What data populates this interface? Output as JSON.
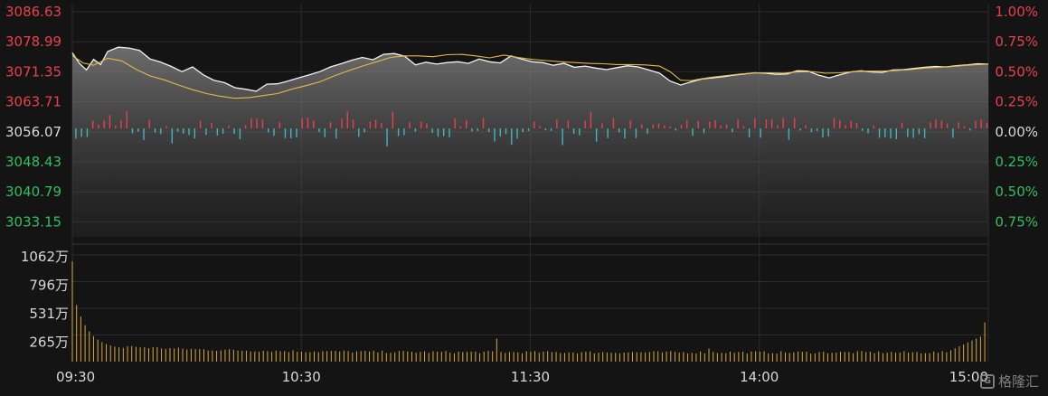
{
  "chart_data": {
    "type": "line",
    "subtype": "intraday-time-sharing",
    "y_left_labels": [
      "3086.63",
      "3078.99",
      "3071.35",
      "3063.71",
      "3056.07",
      "3048.43",
      "3040.79",
      "3033.15"
    ],
    "y_right_labels": [
      "1.00%",
      "0.75%",
      "0.50%",
      "0.25%",
      "0.00%",
      "0.25%",
      "0.50%",
      "0.75%"
    ],
    "y_left_colors": [
      "#e8404a",
      "#e8404a",
      "#e8404a",
      "#e8404a",
      "#d8d8d8",
      "#2ebf5e",
      "#2ebf5e",
      "#2ebf5e"
    ],
    "ylim": [
      3029.33,
      3086.63
    ],
    "base_price": 3056.07,
    "x_tick_labels": [
      "09:30",
      "10:30",
      "11:30",
      "14:00",
      "15:00"
    ],
    "volume_labels": [
      "1062万",
      "796万",
      "531万",
      "265万"
    ],
    "volume_max": 1062,
    "price": [
      [
        0,
        3076.2
      ],
      [
        4,
        3073.5
      ],
      [
        8,
        3071.8
      ],
      [
        12,
        3074.5
      ],
      [
        16,
        3073.2
      ],
      [
        20,
        3076.5
      ],
      [
        26,
        3077.6
      ],
      [
        32,
        3077.4
      ],
      [
        38,
        3076.8
      ],
      [
        44,
        3074.6
      ],
      [
        50,
        3073.8
      ],
      [
        56,
        3072.7
      ],
      [
        62,
        3071.4
      ],
      [
        68,
        3072.6
      ],
      [
        74,
        3070.6
      ],
      [
        80,
        3069.2
      ],
      [
        86,
        3068.6
      ],
      [
        92,
        3067.3
      ],
      [
        98,
        3066.9
      ],
      [
        104,
        3066.4
      ],
      [
        110,
        3068.2
      ],
      [
        116,
        3068.3
      ],
      [
        122,
        3069.0
      ],
      [
        128,
        3069.8
      ],
      [
        134,
        3070.6
      ],
      [
        140,
        3071.4
      ],
      [
        146,
        3072.6
      ],
      [
        152,
        3073.4
      ],
      [
        158,
        3074.3
      ],
      [
        164,
        3075.0
      ],
      [
        170,
        3074.4
      ],
      [
        176,
        3075.8
      ],
      [
        182,
        3076.0
      ],
      [
        188,
        3075.3
      ],
      [
        194,
        3073.1
      ],
      [
        200,
        3073.8
      ],
      [
        206,
        3073.3
      ],
      [
        212,
        3073.7
      ],
      [
        218,
        3073.9
      ],
      [
        224,
        3073.5
      ],
      [
        230,
        3074.6
      ],
      [
        236,
        3073.9
      ],
      [
        242,
        3073.6
      ],
      [
        248,
        3075.4
      ],
      [
        254,
        3074.6
      ],
      [
        260,
        3073.9
      ],
      [
        266,
        3073.7
      ],
      [
        272,
        3073.0
      ],
      [
        278,
        3073.5
      ],
      [
        284,
        3072.5
      ],
      [
        290,
        3072.8
      ],
      [
        296,
        3072.3
      ],
      [
        302,
        3071.9
      ],
      [
        308,
        3072.4
      ],
      [
        314,
        3072.9
      ],
      [
        320,
        3072.6
      ],
      [
        326,
        3071.8
      ],
      [
        332,
        3071.0
      ],
      [
        338,
        3069.0
      ],
      [
        344,
        3068.0
      ],
      [
        350,
        3068.8
      ],
      [
        356,
        3069.5
      ],
      [
        362,
        3069.8
      ],
      [
        368,
        3070.1
      ],
      [
        374,
        3070.5
      ],
      [
        380,
        3070.8
      ],
      [
        386,
        3071.1
      ],
      [
        392,
        3071.0
      ],
      [
        398,
        3070.7
      ],
      [
        404,
        3070.8
      ],
      [
        410,
        3071.6
      ],
      [
        416,
        3071.5
      ],
      [
        422,
        3070.5
      ],
      [
        428,
        3069.8
      ],
      [
        434,
        3070.6
      ],
      [
        440,
        3071.3
      ],
      [
        446,
        3071.6
      ],
      [
        452,
        3071.3
      ],
      [
        458,
        3071.2
      ],
      [
        464,
        3071.8
      ],
      [
        470,
        3071.9
      ],
      [
        476,
        3072.2
      ],
      [
        482,
        3072.5
      ],
      [
        488,
        3072.7
      ],
      [
        494,
        3072.6
      ],
      [
        500,
        3072.9
      ],
      [
        506,
        3073.1
      ],
      [
        512,
        3073.4
      ],
      [
        518,
        3073.3
      ]
    ],
    "avg_price": [
      [
        0,
        3075.5
      ],
      [
        6,
        3073.6
      ],
      [
        12,
        3073.0
      ],
      [
        20,
        3074.8
      ],
      [
        28,
        3074.1
      ],
      [
        36,
        3072.0
      ],
      [
        44,
        3070.3
      ],
      [
        52,
        3069.3
      ],
      [
        60,
        3068.0
      ],
      [
        68,
        3066.8
      ],
      [
        76,
        3065.8
      ],
      [
        84,
        3065.1
      ],
      [
        92,
        3064.6
      ],
      [
        100,
        3064.8
      ],
      [
        108,
        3065.3
      ],
      [
        116,
        3065.8
      ],
      [
        124,
        3066.9
      ],
      [
        132,
        3067.8
      ],
      [
        140,
        3068.8
      ],
      [
        148,
        3070.3
      ],
      [
        156,
        3071.6
      ],
      [
        164,
        3072.8
      ],
      [
        172,
        3073.9
      ],
      [
        180,
        3075.0
      ],
      [
        188,
        3075.4
      ],
      [
        196,
        3075.4
      ],
      [
        204,
        3075.2
      ],
      [
        212,
        3075.7
      ],
      [
        220,
        3075.8
      ],
      [
        228,
        3075.4
      ],
      [
        236,
        3074.9
      ],
      [
        244,
        3075.6
      ],
      [
        252,
        3075.0
      ],
      [
        260,
        3074.5
      ],
      [
        268,
        3074.2
      ],
      [
        276,
        3073.9
      ],
      [
        284,
        3073.7
      ],
      [
        292,
        3073.5
      ],
      [
        300,
        3073.4
      ],
      [
        308,
        3073.2
      ],
      [
        316,
        3073.2
      ],
      [
        324,
        3073.1
      ],
      [
        332,
        3072.8
      ],
      [
        338,
        3071.4
      ],
      [
        344,
        3069.2
      ],
      [
        350,
        3069.1
      ],
      [
        356,
        3069.6
      ],
      [
        362,
        3070.0
      ],
      [
        370,
        3070.4
      ],
      [
        378,
        3070.8
      ],
      [
        386,
        3071.1
      ],
      [
        394,
        3071.1
      ],
      [
        402,
        3071.0
      ],
      [
        410,
        3071.3
      ],
      [
        418,
        3071.4
      ],
      [
        426,
        3071.0
      ],
      [
        434,
        3071.1
      ],
      [
        442,
        3071.4
      ],
      [
        450,
        3071.5
      ],
      [
        458,
        3071.5
      ],
      [
        466,
        3071.7
      ],
      [
        474,
        3071.9
      ],
      [
        482,
        3072.3
      ],
      [
        490,
        3072.5
      ],
      [
        498,
        3072.7
      ],
      [
        506,
        3073.0
      ],
      [
        512,
        3073.2
      ],
      [
        518,
        3073.3
      ]
    ]
  },
  "watermark_text": "格隆汇"
}
